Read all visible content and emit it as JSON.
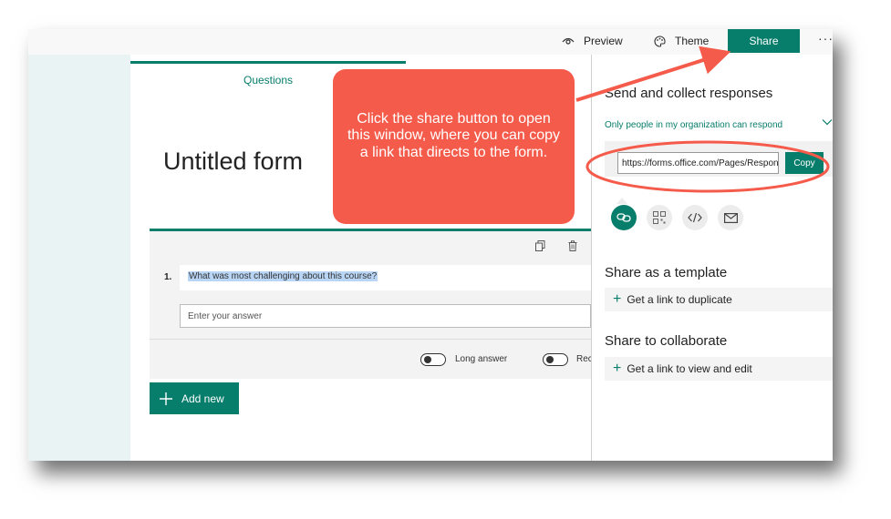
{
  "toolbar": {
    "preview_label": "Preview",
    "theme_label": "Theme",
    "share_label": "Share",
    "more_label": "···"
  },
  "form": {
    "questions_tab": "Questions",
    "title": "Untitled form",
    "question": {
      "number": "1.",
      "text": "What was most challenging about this course?",
      "answer_placeholder": "Enter your answer"
    },
    "long_answer_label": "Long answer",
    "required_label_partial": "Rec",
    "add_new_label": "Add new"
  },
  "share_panel": {
    "heading": "Send and collect responses",
    "permission_selected": "Only people in my organization can respond",
    "link_value": "https://forms.office.com/Pages/Respon",
    "copy_label": "Copy",
    "template_heading": "Share as a template",
    "template_action": "Get a link to duplicate",
    "collaborate_heading": "Share to collaborate",
    "collaborate_action": "Get a link to view and edit"
  },
  "annotation": {
    "callout_text": "Click the share button to open this window, where you can copy a link that directs to the form."
  },
  "icons": [
    "eye-icon",
    "palette-icon",
    "copy-icon",
    "trash-icon",
    "plus-icon",
    "chevron-down-icon",
    "link-icon",
    "qr-code-icon",
    "embed-icon",
    "mail-icon"
  ],
  "colors": {
    "accent": "#077d6b",
    "callout": "#f55b4b",
    "selection": "#b9d5f5"
  }
}
